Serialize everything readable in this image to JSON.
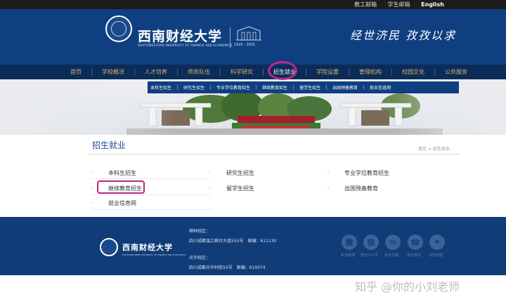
{
  "topbar": {
    "links": [
      "教工邮箱",
      "学生邮箱",
      "English"
    ]
  },
  "header": {
    "school_name": "西南财经大学",
    "school_name_en": "SOUTHWESTERN UNIVERSITY OF FINANCE AND ECONOMICS",
    "years": "1925 · 2021",
    "motto": "经世济民 孜孜以求"
  },
  "nav": {
    "items": [
      "首页",
      "学校概况",
      "人才培养",
      "师资队伍",
      "科学研究",
      "招生就业",
      "学院设置",
      "管理机构",
      "校园文化",
      "公共服务"
    ],
    "active_index": 5
  },
  "subnav": {
    "items": [
      "本科生招生",
      "研究生招生",
      "专业学位教育招生",
      "继续教育招生",
      "留学生招生",
      "出国预备教育",
      "就业信息网"
    ]
  },
  "content": {
    "title": "招生就业",
    "breadcrumb": "首页 > 招生就业",
    "links": [
      [
        "本科生招生",
        "研究生招生",
        "专业学位教育招生"
      ],
      [
        "继续教育招生",
        "留学生招生",
        "出国预备教育"
      ],
      [
        "就业信息网"
      ]
    ]
  },
  "footer": {
    "school_name": "西南财经大学",
    "school_name_en": "SOUTHWESTERN UNIVERSITY OF FINANCE AND ECONOMICS",
    "campus1_label": "柳林校区：",
    "campus1_addr": "四川成都温江柳台大道555号　邮编：611130",
    "campus2_label": "光华校区：",
    "campus2_addr": "四川成都光华村街55号　邮编：610074",
    "icons": [
      {
        "name": "weibo-icon",
        "glyph": "微",
        "label": "新浪微博"
      },
      {
        "name": "wechat-icon",
        "glyph": "信",
        "label": "微信公众号"
      },
      {
        "name": "mail-icon",
        "glyph": "✉",
        "label": "校长信箱"
      },
      {
        "name": "phone-icon",
        "glyph": "☎",
        "label": "电话黄页"
      },
      {
        "name": "map-icon",
        "glyph": "⌖",
        "label": "交通地图"
      }
    ]
  },
  "watermark": "知乎 @你的小刘老师",
  "colors": {
    "header_blue": "#0f3f80",
    "nav_dark": "#0b2b58",
    "nav_gold": "#d8b46d",
    "highlight": "#c2258a"
  }
}
